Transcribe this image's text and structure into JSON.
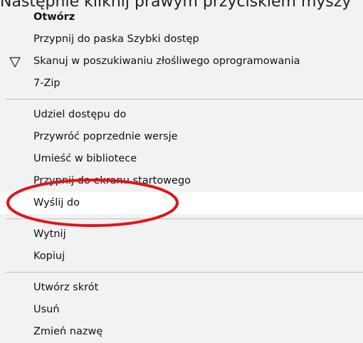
{
  "instruction": "Następnie kliknij prawym przyciskiem myszy",
  "menu": {
    "group1": [
      {
        "label": "Otwórz"
      },
      {
        "label": "Przypnij do paska Szybki dostęp"
      },
      {
        "label": "Skanuj w poszukiwaniu złośliwego oprogramowania",
        "icon": "shield-icon"
      },
      {
        "label": "7-Zip"
      }
    ],
    "group2": [
      {
        "label": "Udziel dostępu do"
      },
      {
        "label": "Przywróć poprzednie wersje"
      },
      {
        "label": "Umieść w bibliotece"
      },
      {
        "label": "Przypnij do ekranu startowego"
      },
      {
        "label": "Wyślij do"
      }
    ],
    "group3": [
      {
        "label": "Wytnij"
      },
      {
        "label": "Kopiuj"
      }
    ],
    "group4": [
      {
        "label": "Utwórz skrót"
      },
      {
        "label": "Usuń"
      },
      {
        "label": "Zmień nazwę"
      }
    ]
  },
  "highlight_color": "#e0141b"
}
